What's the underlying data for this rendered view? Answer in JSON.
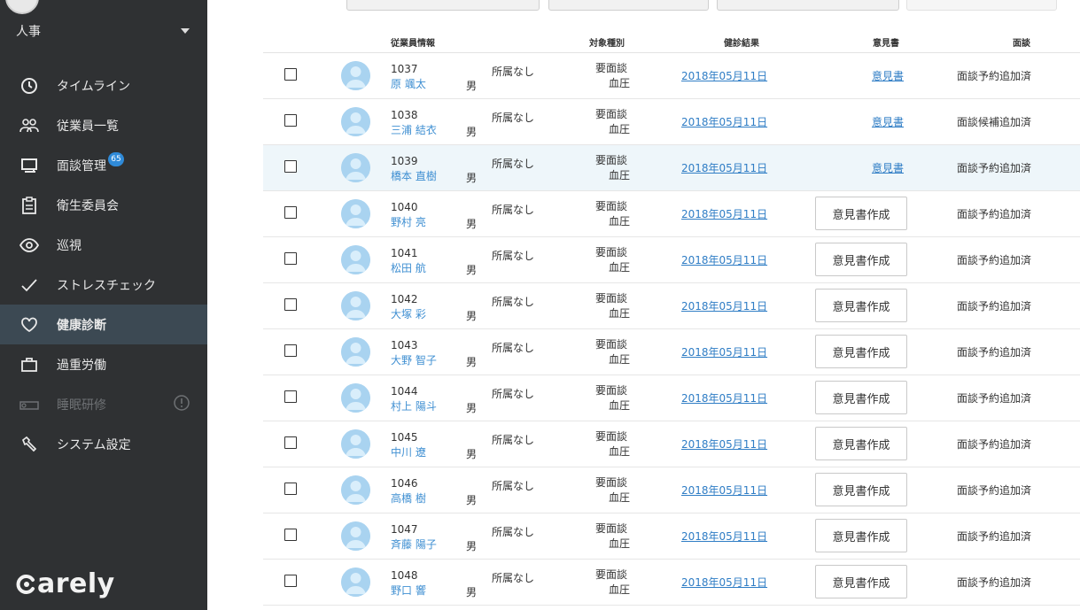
{
  "sidebar": {
    "org_name": "人事",
    "items": [
      {
        "label": "タイムライン",
        "icon": "clock-icon"
      },
      {
        "label": "従業員一覧",
        "icon": "people-icon"
      },
      {
        "label": "面談管理",
        "icon": "meeting-icon",
        "badge": "65"
      },
      {
        "label": "衛生委員会",
        "icon": "clipboard-icon"
      },
      {
        "label": "巡視",
        "icon": "eye-icon"
      },
      {
        "label": "ストレスチェック",
        "icon": "check-icon"
      },
      {
        "label": "健康診断",
        "icon": "heart-icon",
        "active": true
      },
      {
        "label": "過重労働",
        "icon": "briefcase-icon"
      },
      {
        "label": "睡眠研修",
        "icon": "sleep-icon",
        "disabled": true
      },
      {
        "label": "システム設定",
        "icon": "wrench-icon"
      }
    ],
    "logo": "arely"
  },
  "table": {
    "headers": {
      "employee": "従業員情報",
      "target": "対象種別",
      "result": "健診結果",
      "opinion": "意見書",
      "interview": "面談"
    },
    "rows": [
      {
        "id": "1037",
        "name": "原 颯太",
        "sex": "男",
        "dept": "所属なし",
        "target1": "要面談",
        "target2": "血圧",
        "result": "2018年05月11日",
        "opinion": "意見書",
        "opinion_type": "link",
        "interview": "面談予約追加済"
      },
      {
        "id": "1038",
        "name": "三浦 結衣",
        "sex": "男",
        "dept": "所属なし",
        "target1": "要面談",
        "target2": "血圧",
        "result": "2018年05月11日",
        "opinion": "意見書",
        "opinion_type": "link",
        "interview": "面談候補追加済"
      },
      {
        "id": "1039",
        "name": "橋本 直樹",
        "sex": "男",
        "dept": "所属なし",
        "target1": "要面談",
        "target2": "血圧",
        "result": "2018年05月11日",
        "opinion": "意見書",
        "opinion_type": "link",
        "interview": "面談予約追加済"
      },
      {
        "id": "1040",
        "name": "野村 亮",
        "sex": "男",
        "dept": "所属なし",
        "target1": "要面談",
        "target2": "血圧",
        "result": "2018年05月11日",
        "opinion": "意見書作成",
        "opinion_type": "button",
        "interview": "面談予約追加済"
      },
      {
        "id": "1041",
        "name": "松田 航",
        "sex": "男",
        "dept": "所属なし",
        "target1": "要面談",
        "target2": "血圧",
        "result": "2018年05月11日",
        "opinion": "意見書作成",
        "opinion_type": "button",
        "interview": "面談予約追加済"
      },
      {
        "id": "1042",
        "name": "大塚 彩",
        "sex": "男",
        "dept": "所属なし",
        "target1": "要面談",
        "target2": "血圧",
        "result": "2018年05月11日",
        "opinion": "意見書作成",
        "opinion_type": "button",
        "interview": "面談予約追加済"
      },
      {
        "id": "1043",
        "name": "大野 智子",
        "sex": "男",
        "dept": "所属なし",
        "target1": "要面談",
        "target2": "血圧",
        "result": "2018年05月11日",
        "opinion": "意見書作成",
        "opinion_type": "button",
        "interview": "面談予約追加済"
      },
      {
        "id": "1044",
        "name": "村上 陽斗",
        "sex": "男",
        "dept": "所属なし",
        "target1": "要面談",
        "target2": "血圧",
        "result": "2018年05月11日",
        "opinion": "意見書作成",
        "opinion_type": "button",
        "interview": "面談予約追加済"
      },
      {
        "id": "1045",
        "name": "中川 遼",
        "sex": "男",
        "dept": "所属なし",
        "target1": "要面談",
        "target2": "血圧",
        "result": "2018年05月11日",
        "opinion": "意見書作成",
        "opinion_type": "button",
        "interview": "面談予約追加済"
      },
      {
        "id": "1046",
        "name": "高橋 樹",
        "sex": "男",
        "dept": "所属なし",
        "target1": "要面談",
        "target2": "血圧",
        "result": "2018年05月11日",
        "opinion": "意見書作成",
        "opinion_type": "button",
        "interview": "面談予約追加済"
      },
      {
        "id": "1047",
        "name": "斉藤 陽子",
        "sex": "男",
        "dept": "所属なし",
        "target1": "要面談",
        "target2": "血圧",
        "result": "2018年05月11日",
        "opinion": "意見書作成",
        "opinion_type": "button",
        "interview": "面談予約追加済"
      },
      {
        "id": "1048",
        "name": "野口 響",
        "sex": "男",
        "dept": "所属なし",
        "target1": "要面談",
        "target2": "血圧",
        "result": "2018年05月11日",
        "opinion": "意見書作成",
        "opinion_type": "button",
        "interview": "面談予約追加済"
      }
    ],
    "highlighted_row": 2
  },
  "colors": {
    "sidebar_bg": "#2f3133",
    "active_bg": "#3c4953",
    "link": "#2f7dc5",
    "badge": "#2f8ad8"
  }
}
